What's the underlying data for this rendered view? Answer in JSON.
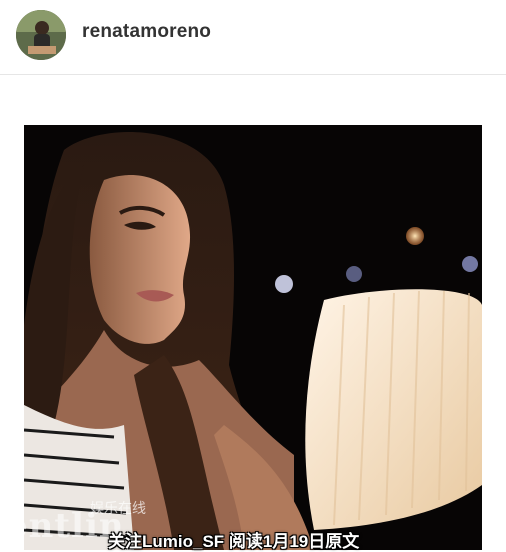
{
  "post": {
    "username": "renatamoreno"
  },
  "watermark": {
    "logo_text": "entlin",
    "tag_text": "娱乐在线",
    "caption": "关注Lumio_SF   阅读1月19日原文"
  }
}
